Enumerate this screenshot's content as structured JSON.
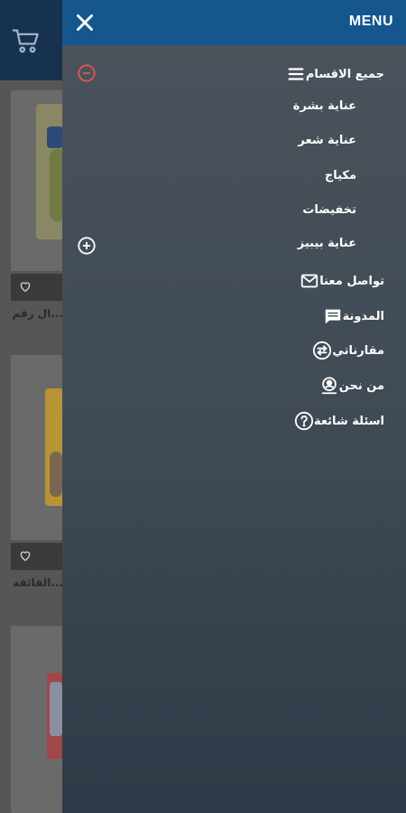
{
  "header": {
    "menu_title": "MENU",
    "close_icon": "close-icon",
    "cart_icon": "cart-icon"
  },
  "menu": {
    "all_categories": {
      "label": "جميع الاقسام",
      "icon": "hamburger-icon",
      "toggle": "collapse-minus-icon"
    },
    "subcategories": [
      {
        "label": "عناية بشرة"
      },
      {
        "label": "عناية شعر"
      },
      {
        "label": "مكياج"
      },
      {
        "label": "تخفيضات"
      },
      {
        "label": "عناية بيبيز",
        "toggle": "expand-plus-icon"
      }
    ],
    "items": [
      {
        "label": "تواصل معنا",
        "icon": "envelope-icon"
      },
      {
        "label": "المدونة",
        "icon": "chat-bubble-icon"
      },
      {
        "label": "مقارناتي",
        "icon": "compare-arrows-icon"
      },
      {
        "label": "من نحن",
        "icon": "about-user-icon"
      },
      {
        "label": "اسئلة شائعة",
        "icon": "help-circle-icon"
      }
    ]
  },
  "background": {
    "product_titles": [
      "...ال رقم",
      "...الفائقة"
    ]
  },
  "colors": {
    "drawer_header": "#16568f",
    "app_header": "#16324f",
    "collapse_accent": "#e0574f"
  }
}
